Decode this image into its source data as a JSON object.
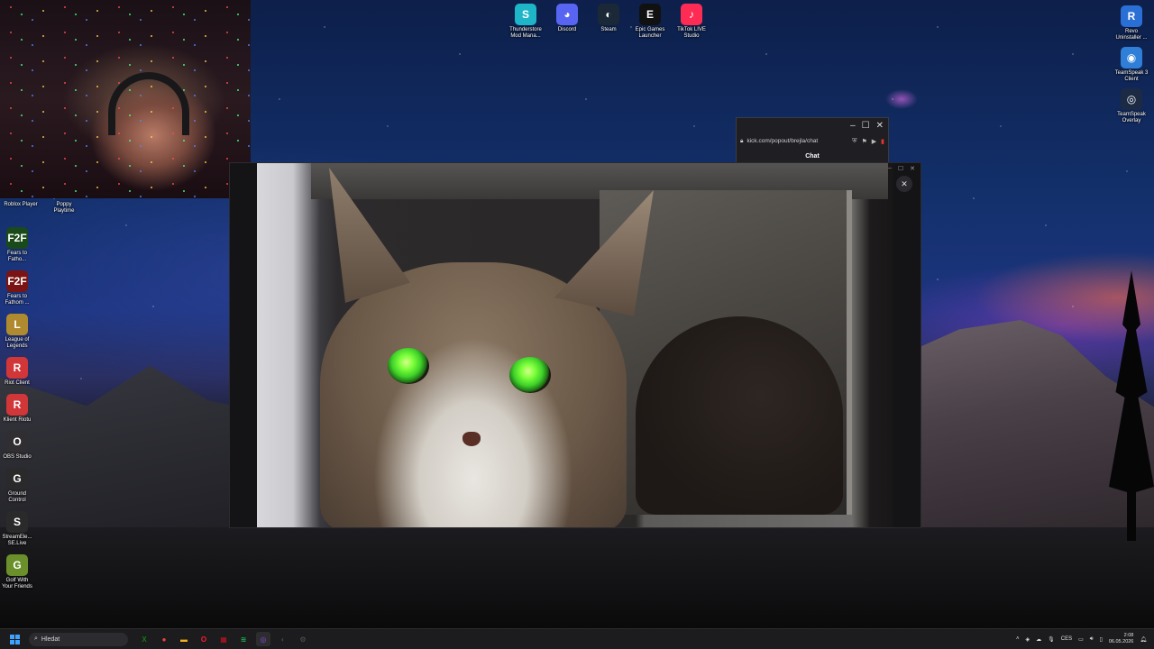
{
  "desktop": {
    "top_icons": [
      {
        "label": "Thunderstore\nMod Mana...",
        "icon": "thunderstore-icon",
        "color": "#1fb5c8"
      },
      {
        "label": "Discord",
        "icon": "discord-icon",
        "color": "#5865f2"
      },
      {
        "label": "Steam",
        "icon": "steam-icon",
        "color": "#1b2838"
      },
      {
        "label": "Epic Games\nLauncher",
        "icon": "epic-games-icon",
        "color": "#111111"
      },
      {
        "label": "TikTok LIVE\nStudio",
        "icon": "tiktok-live-icon",
        "color": "#fe2c55"
      }
    ],
    "right_icons": [
      {
        "label": "Revo\nUninstaller ...",
        "icon": "revo-uninstaller-icon",
        "color": "#2a6fd6"
      },
      {
        "label": "TeamSpeak 3\nClient",
        "icon": "teamspeak-icon",
        "color": "#2f7fd8"
      },
      {
        "label": "TeamSpeak\nOverlay",
        "icon": "teamspeak-overlay-icon",
        "color": "#1c2a44"
      }
    ],
    "top_row_left_icons": [
      {
        "label": "Roblox Player",
        "icon": "roblox-icon"
      },
      {
        "label": "Poppy\nPlaytime",
        "icon": "poppy-playtime-icon"
      }
    ],
    "left_icons": [
      {
        "label": "Fears to\nFatho...",
        "icon": "f2f-icon",
        "glyph": "F2F",
        "color": "#1a4a1a"
      },
      {
        "label": "Fears to\nFathom ...",
        "icon": "f2f-icon",
        "glyph": "F2F",
        "color": "#7a1414"
      },
      {
        "label": "League of\nLegends",
        "icon": "league-of-legends-icon",
        "glyph": "L",
        "color": "#b08a2e"
      },
      {
        "label": "Riot Client",
        "icon": "riot-client-icon",
        "glyph": "R",
        "color": "#d13639"
      },
      {
        "label": "Klient Riotu",
        "icon": "riot-client-icon",
        "glyph": "R",
        "color": "#d13639"
      },
      {
        "label": "OBS Studio",
        "icon": "obs-icon",
        "glyph": "O",
        "color": "#302e31"
      },
      {
        "label": "Ground\nControl",
        "icon": "ground-control-icon",
        "glyph": "G",
        "color": "#2a2a2a"
      },
      {
        "label": "StreamEle...\nSE.Live",
        "icon": "streamelements-icon",
        "glyph": "S",
        "color": "#2a2a2a"
      },
      {
        "label": "Golf With\nYour Friends",
        "icon": "golf-with-friends-icon",
        "glyph": "G",
        "color": "#6b8f2a"
      }
    ]
  },
  "chat_popup": {
    "url": "kick.com/popout/brejla/chat",
    "title": "Chat",
    "minimize": "–",
    "maximize": "☐",
    "close": "✕"
  },
  "viewer": {
    "close_symbol": "✕",
    "window_controls": [
      "–",
      "☐",
      "✕"
    ]
  },
  "taskbar": {
    "search_placeholder": "Hledat",
    "apps": [
      {
        "icon": "xbox-icon",
        "glyph": "X",
        "color": "#107c10"
      },
      {
        "icon": "chrome-icon",
        "glyph": "●",
        "color": "#e8453c"
      },
      {
        "icon": "file-explorer-icon",
        "glyph": "▬",
        "color": "#f2b01e"
      },
      {
        "icon": "opera-icon",
        "glyph": "O",
        "color": "#ff1b2d"
      },
      {
        "icon": "app-red-icon",
        "glyph": "▦",
        "color": "#c4141e"
      },
      {
        "icon": "spotify-icon",
        "glyph": "≋",
        "color": "#1db954"
      },
      {
        "icon": "browser-icon",
        "glyph": "◎",
        "color": "#7b4cd8"
      },
      {
        "icon": "steam-icon",
        "glyph": "◐",
        "color": "#2a475e"
      },
      {
        "icon": "settings-icon",
        "glyph": "⚙",
        "color": "#555555"
      }
    ],
    "language": "CES",
    "time": "2:08",
    "date": "06.05.2026"
  }
}
